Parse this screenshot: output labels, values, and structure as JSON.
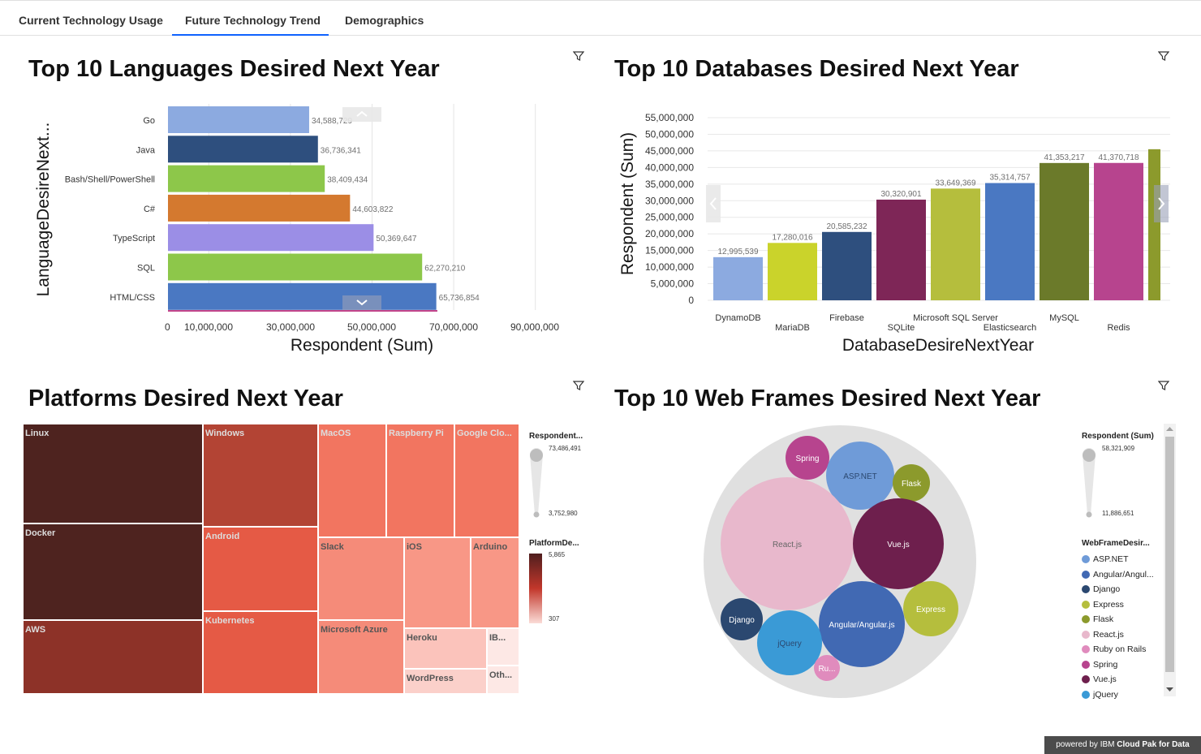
{
  "tabs": [
    "Current Technology Usage",
    "Future Technology Trend",
    "Demographics"
  ],
  "active_tab": "Future Technology Trend",
  "footer": {
    "prefix": "powered by IBM ",
    "brand": "Cloud Pak for Data"
  },
  "panels": {
    "languages": {
      "title": "Top 10 Languages Desired Next Year"
    },
    "databases": {
      "title": "Top 10 Databases Desired Next Year"
    },
    "platforms": {
      "title": "Platforms Desired Next Year"
    },
    "webframes": {
      "title": "Top 10 Web Frames Desired Next Year"
    }
  },
  "chart_data": [
    {
      "id": "languages",
      "type": "bar",
      "orientation": "horizontal",
      "title": "Top 10 Languages Desired Next Year",
      "xlabel": "Respondent (Sum)",
      "ylabel": "LanguageDesireNext...",
      "categories": [
        "Go",
        "Java",
        "Bash/Shell/PowerShell",
        "C#",
        "TypeScript",
        "SQL",
        "HTML/CSS"
      ],
      "values": [
        34588729,
        36736341,
        38409434,
        44603822,
        50369647,
        62270210,
        65736854
      ],
      "value_labels": [
        "34,588,729",
        "36,736,341",
        "38,409,434",
        "44,603,822",
        "50,369,647",
        "62,270,210",
        "65,736,854"
      ],
      "colors": [
        "#8caae0",
        "#2e4f7e",
        "#8dc74a",
        "#d4792f",
        "#9b8ee6",
        "#8dc74a",
        "#4a78c2"
      ],
      "xticks": [
        "0",
        "10,000,000",
        "30,000,000",
        "50,000,000",
        "70,000,000",
        "90,000,000"
      ],
      "xlim": [
        0,
        95000000
      ]
    },
    {
      "id": "databases",
      "type": "bar",
      "orientation": "vertical",
      "title": "Top 10 Databases Desired Next Year",
      "xlabel": "DatabaseDesireNextYear",
      "ylabel": "Respondent (Sum)",
      "categories": [
        "DynamoDB",
        "MariaDB",
        "Firebase",
        "SQLite",
        "Microsoft SQL Server",
        "Elasticsearch",
        "MySQL",
        "Redis"
      ],
      "values": [
        12995539,
        17280016,
        20585232,
        30320901,
        33649369,
        35314757,
        41353217,
        41370718
      ],
      "value_labels": [
        "12,995,539",
        "17,280,016",
        "20,585,232",
        "30,320,901",
        "33,649,369",
        "35,314,757",
        "41,353,217",
        "41,370,718"
      ],
      "colors": [
        "#8caae0",
        "#cad32b",
        "#2e4f7e",
        "#7e2657",
        "#b5be3d",
        "#4a78c2",
        "#6b7a2a",
        "#b7448e"
      ],
      "partial_bar_color": "#8c9a2c",
      "yticks": [
        "0",
        "5,000,000",
        "10,000,000",
        "15,000,000",
        "20,000,000",
        "25,000,000",
        "30,000,000",
        "35,000,000",
        "40,000,000",
        "45,000,000",
        "50,000,000",
        "55,000,000"
      ],
      "ylim": [
        0,
        55000000
      ]
    },
    {
      "id": "platforms",
      "type": "treemap",
      "title": "Platforms Desired Next Year",
      "labels": [
        "Linux",
        "Windows",
        "MacOS",
        "Raspberry Pi",
        "Google Clo...",
        "Docker",
        "Android",
        "Slack",
        "iOS",
        "Arduino",
        "AWS",
        "Kubernetes",
        "Microsoft Azure",
        "Heroku",
        "IB...",
        "WordPress",
        "Oth..."
      ],
      "legend_size": {
        "title": "Respondent...",
        "max": "73,486,491",
        "min": "3,752,980"
      },
      "legend_color": {
        "title": "PlatformDe...",
        "max": "5,865",
        "min": "307"
      }
    },
    {
      "id": "webframes",
      "type": "bubble",
      "title": "Top 10 Web Frames Desired Next Year",
      "labels": [
        "Spring",
        "ASP.NET",
        "Flask",
        "React.js",
        "Vue.js",
        "Express",
        "Django",
        "Angular/Angular.js",
        "jQuery",
        "Ru..."
      ],
      "legend_size": {
        "title": "Respondent (Sum)",
        "max": "58,321,909",
        "min": "11,886,651"
      },
      "legend_title": "WebFrameDesir...",
      "legend_items": [
        {
          "label": "ASP.NET",
          "color": "#6f9bd8"
        },
        {
          "label": "Angular/Angul...",
          "color": "#4169b3"
        },
        {
          "label": "Django",
          "color": "#2b4870"
        },
        {
          "label": "Express",
          "color": "#b5be3d"
        },
        {
          "label": "Flask",
          "color": "#8c9a2c"
        },
        {
          "label": "React.js",
          "color": "#e8b8cc"
        },
        {
          "label": "Ruby on Rails",
          "color": "#e08bbd"
        },
        {
          "label": "Spring",
          "color": "#b7448e"
        },
        {
          "label": "Vue.js",
          "color": "#6e1f4d"
        },
        {
          "label": "jQuery",
          "color": "#3a9ad6"
        }
      ]
    }
  ]
}
